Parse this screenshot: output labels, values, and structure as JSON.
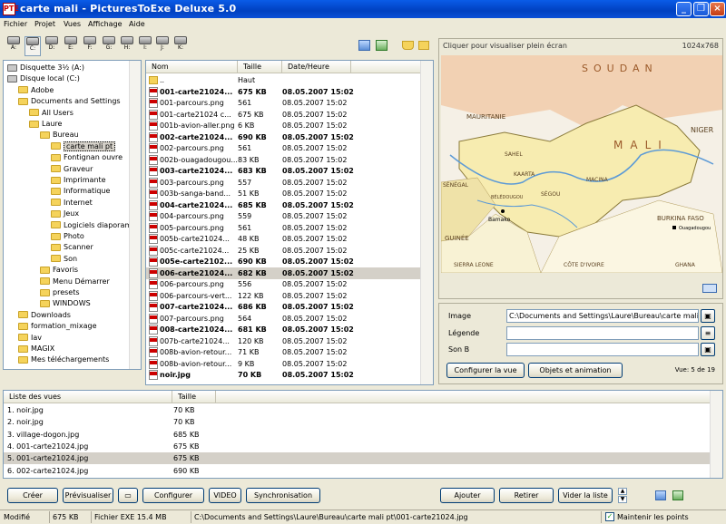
{
  "window": {
    "title": "carte mali - PicturesToExe Deluxe 5.0",
    "app_icon": "PTE"
  },
  "menu": [
    "Fichier",
    "Projet",
    "Vues",
    "Affichage",
    "Aide"
  ],
  "drives": [
    "A:",
    "C:",
    "D:",
    "E:",
    "F:",
    "G:",
    "H:",
    "I:",
    "J:",
    "K:"
  ],
  "tree": [
    {
      "label": "Disquette 3½ (A:)",
      "indent": 0,
      "icon": "floppy"
    },
    {
      "label": "Disque local (C:)",
      "indent": 0,
      "icon": "disk"
    },
    {
      "label": "Adobe",
      "indent": 1,
      "icon": "folder"
    },
    {
      "label": "Documents and Settings",
      "indent": 1,
      "icon": "folder"
    },
    {
      "label": "All Users",
      "indent": 2,
      "icon": "folder"
    },
    {
      "label": "Laure",
      "indent": 2,
      "icon": "folder"
    },
    {
      "label": "Bureau",
      "indent": 3,
      "icon": "folder"
    },
    {
      "label": "carte mali pt",
      "indent": 4,
      "icon": "folder",
      "selected": true
    },
    {
      "label": "Fontignan ouvre",
      "indent": 4,
      "icon": "folder"
    },
    {
      "label": "Graveur",
      "indent": 4,
      "icon": "folder"
    },
    {
      "label": "Imprimante",
      "indent": 4,
      "icon": "folder"
    },
    {
      "label": "Informatique",
      "indent": 4,
      "icon": "folder"
    },
    {
      "label": "Internet",
      "indent": 4,
      "icon": "folder"
    },
    {
      "label": "Jeux",
      "indent": 4,
      "icon": "folder"
    },
    {
      "label": "Logiciels diaporam",
      "indent": 4,
      "icon": "folder"
    },
    {
      "label": "Photo",
      "indent": 4,
      "icon": "folder"
    },
    {
      "label": "Scanner",
      "indent": 4,
      "icon": "folder"
    },
    {
      "label": "Son",
      "indent": 4,
      "icon": "folder"
    },
    {
      "label": "Favoris",
      "indent": 3,
      "icon": "folder"
    },
    {
      "label": "Menu Démarrer",
      "indent": 3,
      "icon": "folder"
    },
    {
      "label": "presets",
      "indent": 3,
      "icon": "folder"
    },
    {
      "label": "WINDOWS",
      "indent": 3,
      "icon": "folder"
    },
    {
      "label": "Downloads",
      "indent": 1,
      "icon": "folder"
    },
    {
      "label": "formation_mixage",
      "indent": 1,
      "icon": "folder"
    },
    {
      "label": "Iav",
      "indent": 1,
      "icon": "folder"
    },
    {
      "label": "MAGIX",
      "indent": 1,
      "icon": "folder"
    },
    {
      "label": "Mes téléchargements",
      "indent": 1,
      "icon": "folder"
    }
  ],
  "file_headers": {
    "name": "Nom",
    "size": "Taille",
    "date": "Date/Heure"
  },
  "files": [
    {
      "name": "..",
      "size": "Haut",
      "date": "",
      "type": "folder"
    },
    {
      "name": "001-carte21024...",
      "size": "675 KB",
      "date": "08.05.2007 15:02",
      "bold": true
    },
    {
      "name": "001-parcours.png",
      "size": "561",
      "date": "08.05.2007 15:02"
    },
    {
      "name": "001-carte21024 c...",
      "size": "675 KB",
      "date": "08.05.2007 15:02"
    },
    {
      "name": "001b-avion-aller.png",
      "size": "6 KB",
      "date": "08.05.2007 15:02"
    },
    {
      "name": "002-carte21024...",
      "size": "690 KB",
      "date": "08.05.2007 15:02",
      "bold": true
    },
    {
      "name": "002-parcours.png",
      "size": "561",
      "date": "08.05.2007 15:02"
    },
    {
      "name": "002b-ouagadougou...",
      "size": "83 KB",
      "date": "08.05.2007 15:02"
    },
    {
      "name": "003-carte21024...",
      "size": "683 KB",
      "date": "08.05.2007 15:02",
      "bold": true
    },
    {
      "name": "003-parcours.png",
      "size": "557",
      "date": "08.05.2007 15:02"
    },
    {
      "name": "003b-sanga-band...",
      "size": "51 KB",
      "date": "08.05.2007 15:02"
    },
    {
      "name": "004-carte21024...",
      "size": "685 KB",
      "date": "08.05.2007 15:02",
      "bold": true
    },
    {
      "name": "004-parcours.png",
      "size": "559",
      "date": "08.05.2007 15:02"
    },
    {
      "name": "005-parcours.png",
      "size": "561",
      "date": "08.05.2007 15:02"
    },
    {
      "name": "005b-carte21024...",
      "size": "48 KB",
      "date": "08.05.2007 15:02"
    },
    {
      "name": "005c-carte21024...",
      "size": "25 KB",
      "date": "08.05.2007 15:02"
    },
    {
      "name": "005e-carte2102...",
      "size": "690 KB",
      "date": "08.05.2007 15:02",
      "bold": true
    },
    {
      "name": "006-carte21024...",
      "size": "682 KB",
      "date": "08.05.2007 15:02",
      "bold": true,
      "selected": true
    },
    {
      "name": "006-parcours.png",
      "size": "556",
      "date": "08.05.2007 15:02"
    },
    {
      "name": "006-parcours-vert...",
      "size": "122 KB",
      "date": "08.05.2007 15:02"
    },
    {
      "name": "007-carte21024...",
      "size": "686 KB",
      "date": "08.05.2007 15:02",
      "bold": true
    },
    {
      "name": "007-parcours.png",
      "size": "564",
      "date": "08.05.2007 15:02"
    },
    {
      "name": "008-carte21024...",
      "size": "681 KB",
      "date": "08.05.2007 15:02",
      "bold": true
    },
    {
      "name": "007b-carte21024...",
      "size": "120 KB",
      "date": "08.05.2007 15:02"
    },
    {
      "name": "008b-avion-retour...",
      "size": "71 KB",
      "date": "08.05.2007 15:02"
    },
    {
      "name": "008b-avion-retour...",
      "size": "9 KB",
      "date": "08.05.2007 15:02"
    },
    {
      "name": "noir.jpg",
      "size": "70 KB",
      "date": "08.05.2007 15:02",
      "bold": true
    }
  ],
  "preview": {
    "tooltip": "Cliquer pour visualiser plein écran",
    "resolution": "1024x768",
    "map_labels": [
      "SOUDAN",
      "MAURITANIE",
      "MALI",
      "NIGER",
      "SÉNÉGAL",
      "BURKINA FASO",
      "GUINÉE",
      "CÔTE D'IVOIRE",
      "GHANA",
      "SIERRA LEONE",
      "Bamako",
      "Ouagadougou",
      "BÉLÉDOUGOU",
      "KAARTA",
      "SAHEL",
      "MACINA",
      "SÉGOU"
    ]
  },
  "info": {
    "image_label": "Image",
    "image_value": "C:\\Documents and Settings\\Laure\\Bureau\\carte mali pt\\",
    "legend_label": "Légende",
    "legend_value": "",
    "sound_label": "Son B",
    "sound_value": "",
    "config_button": "Configurer la vue",
    "objects_button": "Objets et animation",
    "view_counter": "Vue: 5 de 19"
  },
  "views_headers": {
    "name": "Liste des vues",
    "size": "Taille"
  },
  "views": [
    {
      "name": "1. noir.jpg",
      "size": "70 KB"
    },
    {
      "name": "2. noir.jpg",
      "size": "70 KB"
    },
    {
      "name": "3. village-dogon.jpg",
      "size": "685 KB"
    },
    {
      "name": "4. 001-carte21024.jpg",
      "size": "675 KB"
    },
    {
      "name": "5. 001-carte21024.jpg",
      "size": "675 KB",
      "selected": true
    },
    {
      "name": "6. 002-carte21024.jpg",
      "size": "690 KB"
    }
  ],
  "buttons": {
    "create": "Créer",
    "preview": "Prévisualiser",
    "configure": "Configurer",
    "video": "VIDEO",
    "sync": "Synchronisation",
    "add": "Ajouter",
    "remove": "Retirer",
    "clear": "Vider la liste"
  },
  "status": {
    "modified": "Modifié",
    "file_size": "675 KB",
    "exe_file": "Fichier EXE   15.4 MB",
    "path": "C:\\Documents and Settings\\Laure\\Bureau\\carte mali pt\\001-carte21024.jpg",
    "keep_points": "Maintenir les points"
  },
  "colors": {
    "title_bar": "#0a5ce8",
    "selection": "#d4d0c8",
    "map_mali": "#f7ecb0",
    "map_water": "#9fc6e8"
  }
}
